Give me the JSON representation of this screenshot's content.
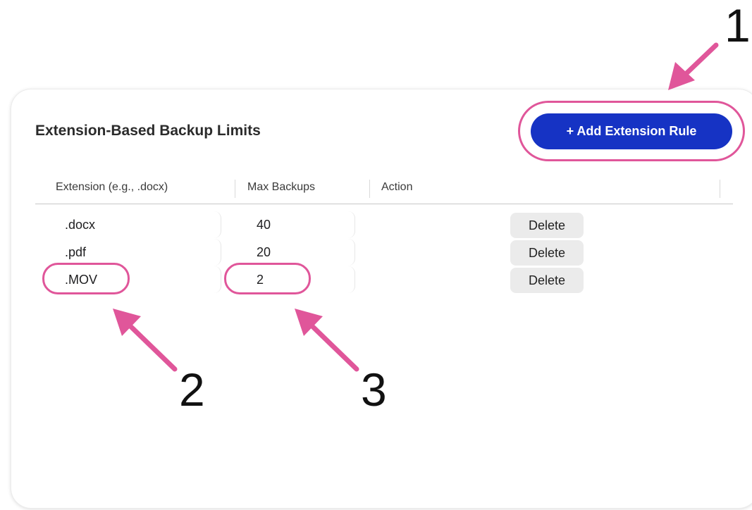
{
  "section": {
    "title": "Extension-Based Backup Limits",
    "add_button_label": "+ Add Extension Rule"
  },
  "table": {
    "headers": [
      "Extension (e.g., .docx)",
      "Max Backups",
      "Action"
    ],
    "rows": [
      {
        "extension": ".docx",
        "max_backups": "40",
        "action": "Delete"
      },
      {
        "extension": ".pdf",
        "max_backups": "20",
        "action": "Delete"
      },
      {
        "extension": ".MOV",
        "max_backups": "2",
        "action": "Delete"
      }
    ]
  },
  "annotations": {
    "labels": [
      "1",
      "2",
      "3"
    ],
    "color": "#e0569a"
  },
  "colors": {
    "accent": "#1633c4",
    "highlight": "#e0569a",
    "delete_bg": "#ebebeb"
  }
}
